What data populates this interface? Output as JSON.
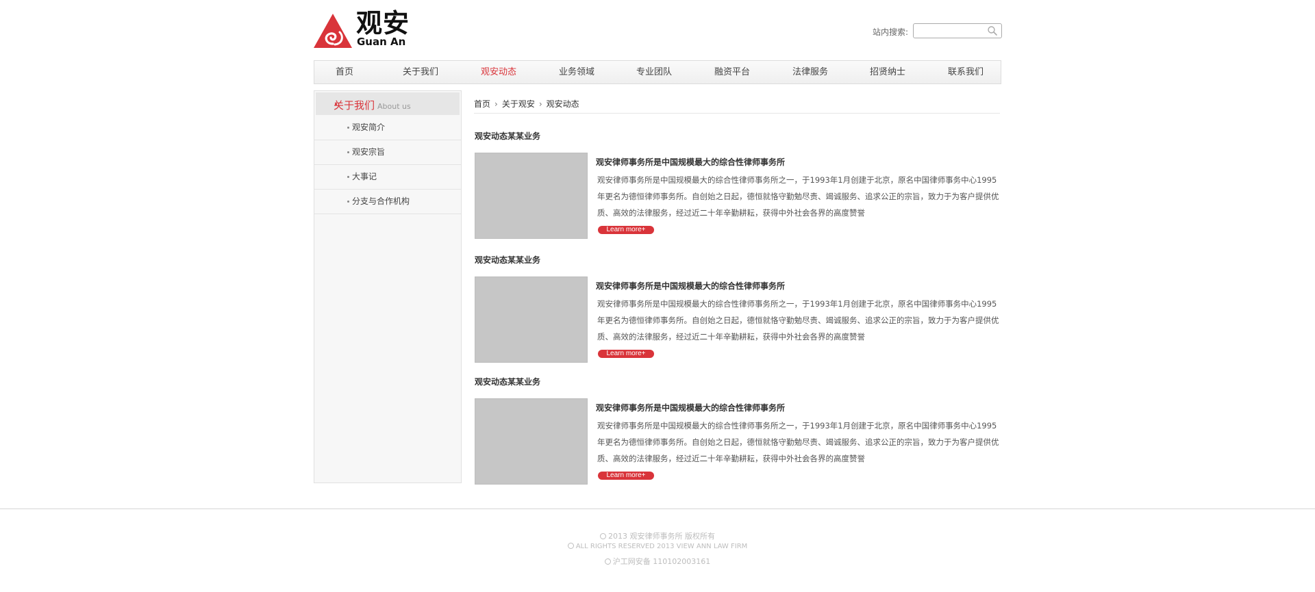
{
  "brand": {
    "name_cn": "观安",
    "name_en": "Guan An",
    "accent_color": "#d9343a",
    "icon": "guan-an-logo-icon"
  },
  "search": {
    "label": "站内搜索:",
    "placeholder": "",
    "value": "",
    "icon": "search-icon"
  },
  "nav": {
    "items": [
      {
        "label": "首页"
      },
      {
        "label": "关于我们"
      },
      {
        "label": "观安动态",
        "active": true
      },
      {
        "label": "业务领域"
      },
      {
        "label": "专业团队"
      },
      {
        "label": "融资平台"
      },
      {
        "label": "法律服务"
      },
      {
        "label": "招贤纳士"
      },
      {
        "label": "联系我们"
      }
    ]
  },
  "sidebar": {
    "title": "关于我们",
    "title_en": "About us",
    "items": [
      {
        "label": "观安简介"
      },
      {
        "label": "观安宗旨"
      },
      {
        "label": "大事记"
      },
      {
        "label": "分支与合作机构"
      }
    ]
  },
  "breadcrumb": {
    "items": [
      "首页",
      "关于观安",
      "观安动态"
    ]
  },
  "articles": [
    {
      "section": "观安动态某某业务",
      "title": "观安律师事务所是中国规模最大的综合性律师事务所",
      "body": "观安律师事务所是中国规模最大的综合性律师事务所之一，于1993年1月创建于北京，原名中国律师事务中心1995年更名为德恒律师事务所。自创始之日起，德恒就恪守勤勉尽责、竭诚服务、追求公正的宗旨，致力于为客户提供优质、高效的法律服务，经过近二十年辛勤耕耘，获得中外社会各界的高度赞誉",
      "more": "Learn more+"
    },
    {
      "section": "观安动态某某业务",
      "title": "观安律师事务所是中国规模最大的综合性律师事务所",
      "body": "观安律师事务所是中国规模最大的综合性律师事务所之一，于1993年1月创建于北京，原名中国律师事务中心1995年更名为德恒律师事务所。自创始之日起，德恒就恪守勤勉尽责、竭诚服务、追求公正的宗旨，致力于为客户提供优质、高效的法律服务，经过近二十年辛勤耕耘，获得中外社会各界的高度赞誉",
      "more": "Learn more+"
    },
    {
      "section": "观安动态某某业务",
      "title": "观安律师事务所是中国规模最大的综合性律师事务所",
      "body": "观安律师事务所是中国规模最大的综合性律师事务所之一，于1993年1月创建于北京，原名中国律师事务中心1995年更名为德恒律师事务所。自创始之日起，德恒就恪守勤勉尽责、竭诚服务、追求公正的宗旨，致力于为客户提供优质、高效的法律服务，经过近二十年辛勤耕耘，获得中外社会各界的高度赞誉",
      "more": "Learn more+"
    }
  ],
  "footer": {
    "line1": "2013  观安律师事务所  版权所有",
    "line2": "ALL RIGHTS RESERVED 2013 VIEW ANN LAW FIRM",
    "line3": "沪工网安备  110102003161"
  }
}
